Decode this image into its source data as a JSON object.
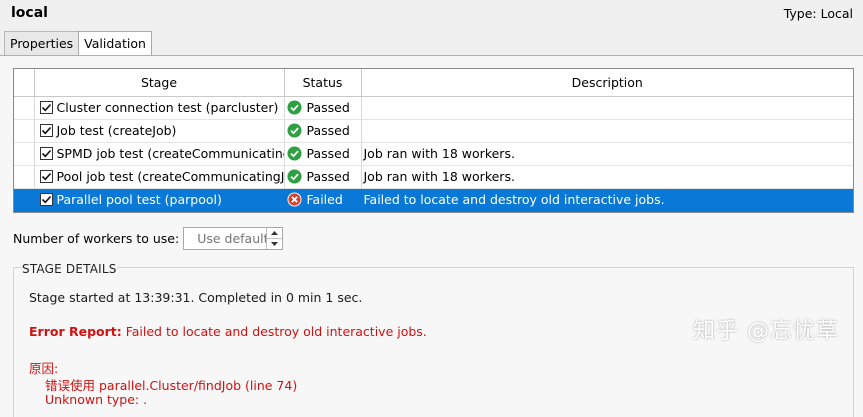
{
  "header": {
    "profile_name": "local",
    "type_label": "Type: Local"
  },
  "tabs": [
    {
      "label": "Properties"
    },
    {
      "label": "Validation"
    }
  ],
  "table": {
    "columns": {
      "stage": "Stage",
      "status": "Status",
      "description": "Description"
    },
    "rows": [
      {
        "stage": "Cluster connection test (parcluster)",
        "status": "Passed",
        "description": "",
        "checked": true,
        "selected": false
      },
      {
        "stage": "Job test (createJob)",
        "status": "Passed",
        "description": "",
        "checked": true,
        "selected": false
      },
      {
        "stage": "SPMD job test (createCommunicatingJob)",
        "status": "Passed",
        "description": "Job ran with 18 workers.",
        "checked": true,
        "selected": false
      },
      {
        "stage": "Pool job test (createCommunicatingJob)",
        "status": "Passed",
        "description": "Job ran with 18 workers.",
        "checked": true,
        "selected": false
      },
      {
        "stage": "Parallel pool test (parpool)",
        "status": "Failed",
        "description": "Failed to locate and destroy old interactive jobs.",
        "checked": true,
        "selected": true
      }
    ]
  },
  "workers": {
    "label": "Number of workers to use:",
    "placeholder": "Use default"
  },
  "details": {
    "title": "STAGE DETAILS",
    "started": "Stage started at 13:39:31.  Completed in 0 min 1 sec.",
    "error_label": "Error Report:",
    "error_message": " Failed to locate and destroy old interactive jobs.",
    "cause_label": "原因:",
    "cause_line1": "错误使用 parallel.Cluster/findJob (line 74)",
    "cause_line2": "Unknown type: ."
  },
  "watermark": "知乎 @忘忧草",
  "colors": {
    "selected_row": "#0a78d7",
    "passed": "#2ea043",
    "failed": "#d8432f",
    "error_text": "#d21010"
  },
  "icons": {
    "passed": "check-circle-icon",
    "failed": "x-circle-icon",
    "checkbox": "checkbox-checked-icon"
  }
}
